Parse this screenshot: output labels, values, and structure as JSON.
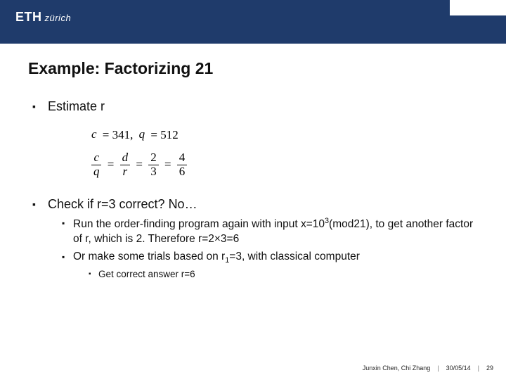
{
  "logo": {
    "main": "ETH",
    "sub": "zürich"
  },
  "title": "Example: Factorizing 21",
  "b1": "Estimate r",
  "math": {
    "line1": {
      "c": "c",
      "eq1": "= 341,",
      "q": "q",
      "eq2": "= 512"
    },
    "fracs": {
      "f1n": "c",
      "f1d": "q",
      "f2n": "d",
      "f2d": "r",
      "f3n": "2",
      "f3d": "3",
      "f4n": "4",
      "f4d": "6"
    }
  },
  "b2": "Check if r=3 correct? No…",
  "s1a": "Run the order-finding program again with input x=10",
  "s1exp": "3",
  "s1b": "(mod21), to get another factor of r, which is 2. Therefore r=2×3=6",
  "s2a": "Or make some trials based on r",
  "s2sub": "1",
  "s2b": "=3, with classical computer",
  "s3": "Get correct answer r=6",
  "footer": {
    "authors": "Junxin Chen, Chi Zhang",
    "date": "30/05/14",
    "page": "29"
  }
}
